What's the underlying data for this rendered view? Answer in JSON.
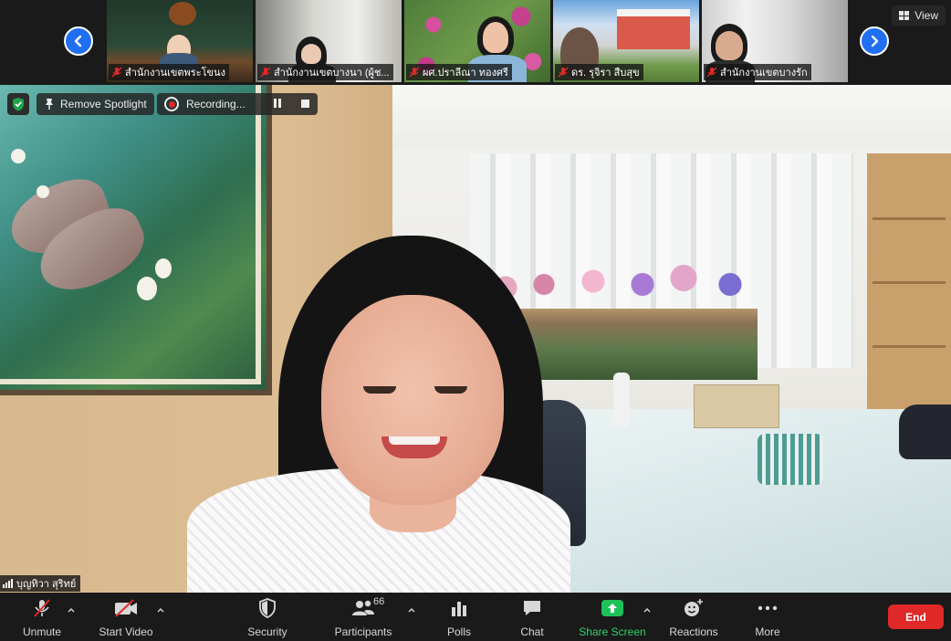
{
  "strip": {
    "view_label": "View",
    "participants": [
      {
        "name": "สำนักงานเขตพระโขนง",
        "muted": true
      },
      {
        "name": "สำนักงานเขตบางนา (ผู้ช...",
        "muted": true
      },
      {
        "name": "ผศ.ปราลีณา ทองศรี",
        "muted": true
      },
      {
        "name": "ดร. รุจิรา สืบสุข",
        "muted": true
      },
      {
        "name": "สำนักงานเขตบางรัก",
        "muted": true
      }
    ]
  },
  "stage": {
    "remove_spotlight_label": "Remove Spotlight",
    "recording_label": "Recording...",
    "speaker_name": "บุญทิวา สุริทย์"
  },
  "toolbar": {
    "unmute_label": "Unmute",
    "start_video_label": "Start Video",
    "security_label": "Security",
    "participants_label": "Participants",
    "participants_count": "66",
    "polls_label": "Polls",
    "chat_label": "Chat",
    "share_screen_label": "Share Screen",
    "reactions_label": "Reactions",
    "more_label": "More",
    "end_label": "End"
  },
  "colors": {
    "accent_blue": "#1f6ff0",
    "share_green": "#1fc25a",
    "end_red": "#e02828",
    "muted_red": "#e02828",
    "security_green": "#1fa34a"
  },
  "icons": {
    "prev": "chevron-left-icon",
    "next": "chevron-right-icon",
    "view": "grid-icon",
    "shield": "shield-check-icon",
    "spotlight": "pin-icon",
    "record": "record-icon",
    "pause": "pause-icon",
    "stop": "stop-icon",
    "mic_off": "mic-off-icon",
    "video_off": "video-off-icon",
    "security": "shield-icon",
    "participants": "people-icon",
    "polls": "bar-chart-icon",
    "chat": "chat-bubble-icon",
    "share": "share-arrow-icon",
    "reactions": "emoji-plus-icon",
    "more": "ellipsis-icon"
  }
}
